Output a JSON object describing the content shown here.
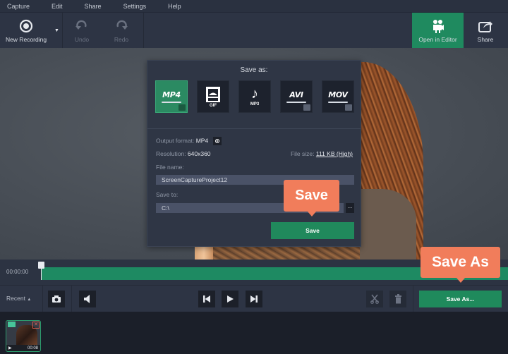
{
  "menu": [
    "Capture",
    "Edit",
    "Share",
    "Settings",
    "Help"
  ],
  "toolbar": {
    "new_recording": "New Recording",
    "undo": "Undo",
    "redo": "Redo",
    "open_in_editor": "Open in Editor",
    "share": "Share"
  },
  "dialog": {
    "title": "Save as:",
    "formats": [
      {
        "id": "mp4",
        "label": "MP4",
        "selected": true
      },
      {
        "id": "gif",
        "label": "GIF",
        "selected": false
      },
      {
        "id": "mp3",
        "label": "MP3",
        "selected": false
      },
      {
        "id": "avi",
        "label": "AVI",
        "selected": false
      },
      {
        "id": "mov",
        "label": "MOV",
        "selected": false
      }
    ],
    "output_format_label": "Output format:",
    "output_format_value": "MP4",
    "resolution_label": "Resolution:",
    "resolution_value": "640x360",
    "file_size_label": "File size:",
    "file_size_value": "111 KB (High)",
    "file_name_label": "File name:",
    "file_name_value": "ScreenCaptureProject12",
    "save_to_label": "Save to:",
    "save_to_value": "C:\\",
    "browse_label": "...",
    "save_button": "Save"
  },
  "callouts": {
    "save": "Save",
    "save_as": "Save As"
  },
  "timeline": {
    "timecode": "00:00:00"
  },
  "controls": {
    "recent": "Recent",
    "save_as_button": "Save As..."
  },
  "recent_items": [
    {
      "duration": "00:08"
    }
  ],
  "colors": {
    "accent_green": "#1f8a5c",
    "callout_orange": "#f17d5b",
    "panel": "#2d3444"
  }
}
